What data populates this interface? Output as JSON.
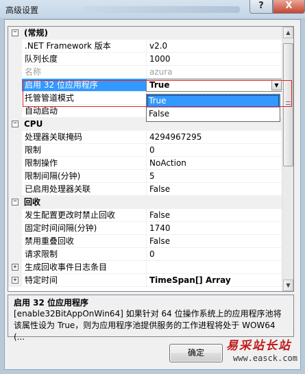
{
  "window": {
    "title": "高级设置",
    "help_label": "?",
    "close_label": "X"
  },
  "grid": {
    "rows": [
      {
        "kind": "category",
        "name": "(常规)",
        "toggle": "−"
      },
      {
        "kind": "prop",
        "name": ".NET Framework 版本",
        "value": "v2.0"
      },
      {
        "kind": "prop",
        "name": "队列长度",
        "value": "1000"
      },
      {
        "kind": "prop",
        "name": "名称",
        "value": "azura",
        "disabled": true
      },
      {
        "kind": "prop",
        "name": "启用 32 位应用程序",
        "value": "True",
        "selected": true,
        "combo": true
      },
      {
        "kind": "prop",
        "name": "托管管道模式",
        "value": ""
      },
      {
        "kind": "prop",
        "name": "自动启动",
        "value": ""
      },
      {
        "kind": "category",
        "name": "CPU",
        "toggle": "−"
      },
      {
        "kind": "prop",
        "name": "处理器关联掩码",
        "value": "4294967295"
      },
      {
        "kind": "prop",
        "name": "限制",
        "value": "0"
      },
      {
        "kind": "prop",
        "name": "限制操作",
        "value": "NoAction"
      },
      {
        "kind": "prop",
        "name": "限制间隔(分钟)",
        "value": "5"
      },
      {
        "kind": "prop",
        "name": "已启用处理器关联",
        "value": "False"
      },
      {
        "kind": "category",
        "name": "回收",
        "toggle": "−"
      },
      {
        "kind": "prop",
        "name": "发生配置更改时禁止回收",
        "value": "False"
      },
      {
        "kind": "prop",
        "name": "固定时间间隔(分钟)",
        "value": "1740"
      },
      {
        "kind": "prop",
        "name": "禁用重叠回收",
        "value": "False"
      },
      {
        "kind": "prop",
        "name": "请求限制",
        "value": "0"
      },
      {
        "kind": "prop",
        "name": "生成回收事件日志条目",
        "value": "",
        "expandable": true
      },
      {
        "kind": "prop",
        "name": "特定时间",
        "value": "TimeSpan[] Array",
        "expandable": true,
        "bold": true
      }
    ],
    "dropdown_options": [
      "True",
      "False"
    ],
    "dropdown_highlighted": "True"
  },
  "description": {
    "title": "启用 32 位应用程序",
    "body": "[enable32BitAppOnWin64] 如果针对 64 位操作系统上的应用程序池将该属性设为 True，则为应用程序池提供服务的工作进程将处于 WOW64 (..."
  },
  "buttons": {
    "ok_label": "确定"
  },
  "watermark": {
    "text": "易采站长站",
    "url": "www.easck.com"
  }
}
